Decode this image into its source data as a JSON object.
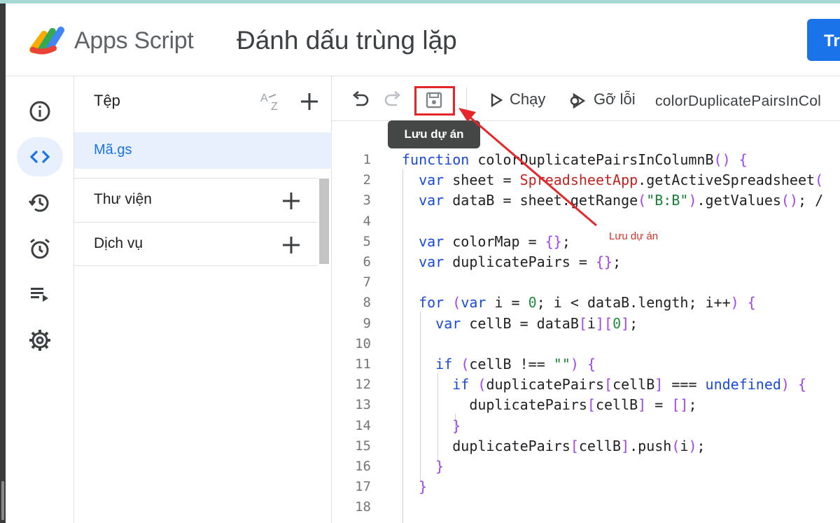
{
  "header": {
    "app_name": "Apps Script",
    "project_name": "Đánh dấu trùng lặp",
    "deploy_label": "Tr"
  },
  "rail": {
    "items": [
      "info-icon",
      "code-icon",
      "history-icon",
      "alarm-icon",
      "executions-icon",
      "settings-icon"
    ],
    "active": "code-icon"
  },
  "files": {
    "title": "Tệp",
    "file_name": "Mã.gs",
    "libraries_label": "Thư viện",
    "services_label": "Dịch vụ"
  },
  "toolbar": {
    "run_label": "Chạy",
    "debug_label": "Gỡ lỗi",
    "function_name": "colorDuplicatePairsInCol"
  },
  "tooltip": {
    "save_tooltip": "Lưu dự án"
  },
  "annotation": {
    "label": "Lưu dự án",
    "color": "#e5262b"
  },
  "editor": {
    "line_numbers": [
      "1",
      "2",
      "3",
      "4",
      "5",
      "6",
      "7",
      "8",
      "9",
      "10",
      "11",
      "12",
      "13",
      "14",
      "15",
      "16",
      "17",
      "18"
    ],
    "lines": [
      "function colorDuplicatePairsInColumnB() {",
      "  var sheet = SpreadsheetApp.getActiveSpreadsheet(",
      "  var dataB = sheet.getRange(\"B:B\").getValues(); /",
      "",
      "  var colorMap = {};",
      "  var duplicatePairs = {};",
      "",
      "  for (var i = 0; i < dataB.length; i++) {",
      "    var cellB = dataB[i][0];",
      "",
      "    if (cellB !== \"\") {",
      "      if (duplicatePairs[cellB] === undefined) {",
      "        duplicatePairs[cellB] = [];",
      "      }",
      "      duplicatePairs[cellB].push(i);",
      "    }",
      "  }",
      ""
    ]
  },
  "colors": {
    "accent": "#1a73e8",
    "highlight": "#e8f0fe",
    "annotation": "#e5262b"
  }
}
